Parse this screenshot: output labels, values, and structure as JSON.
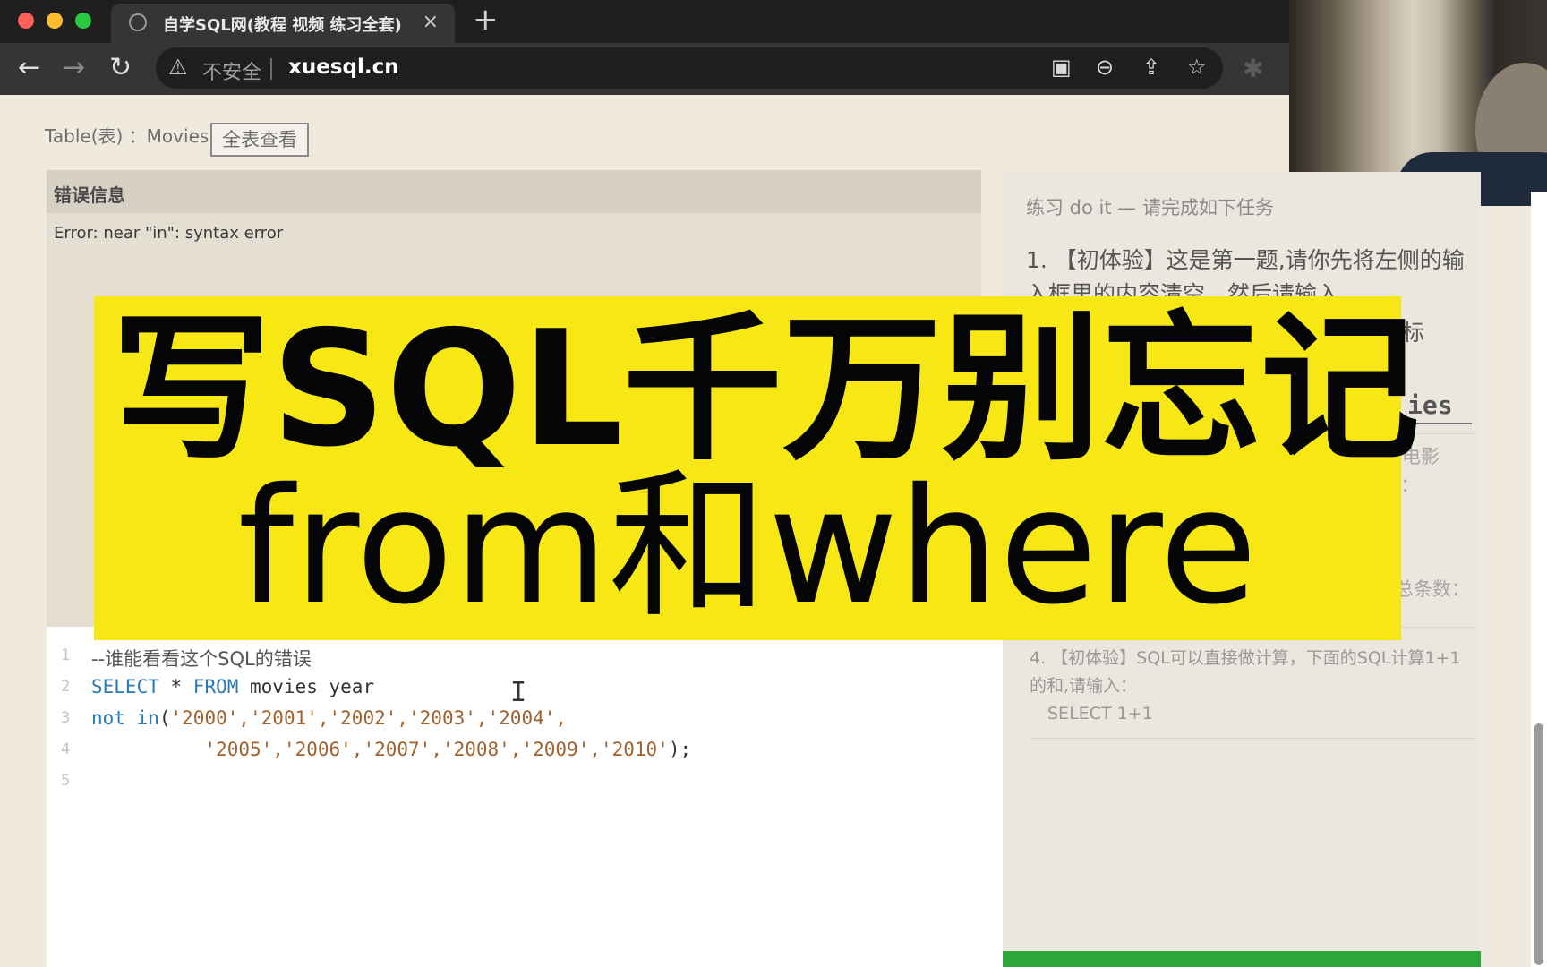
{
  "browser": {
    "tab_title": "自学SQL网(教程 视频 练习全套)",
    "tab_close": "×",
    "new_tab": "+",
    "insecure_label": "不安全",
    "url": "xuesql.cn"
  },
  "table_bar": {
    "label": "Table(表) ：Movies",
    "view_all_button": "全表查看"
  },
  "error_panel": {
    "title": "错误信息",
    "message": "Error: near \"in\": syntax error"
  },
  "editor": {
    "line_numbers": [
      "1",
      "2",
      "3",
      "4",
      "5"
    ],
    "line1_comment": "--谁能看看这个SQL的错误",
    "line2": {
      "kw1": "SELECT",
      "mid": " * ",
      "kw2": "FROM",
      "rest": " movies year"
    },
    "line3": {
      "kw": "not in",
      "open": "(",
      "values": "'2000','2001','2002','2003','2004',"
    },
    "line4": {
      "values": "'2005','2006','2007','2008','2009','2010'",
      "close": ");"
    }
  },
  "task_panel": {
    "heading": "练习 do it — 请完成如下任务",
    "task1": "1. 【初体验】这是第一题,请你先将左侧的输入框里的内容清空，然后请输入",
    "task1_frag": "标",
    "table_frag": "ies",
    "movie_frag": "电影",
    "colon_frag": "）：",
    "count_frag": "总条数：",
    "task4": "4. 【初体验】SQL可以直接做计算，下面的SQL计算1+1的和,请输入：",
    "task4_sql": "SELECT 1+1"
  },
  "banner": {
    "line1": "写SQL千万别忘记",
    "line2": "from和where",
    "color": "#f7e815"
  }
}
